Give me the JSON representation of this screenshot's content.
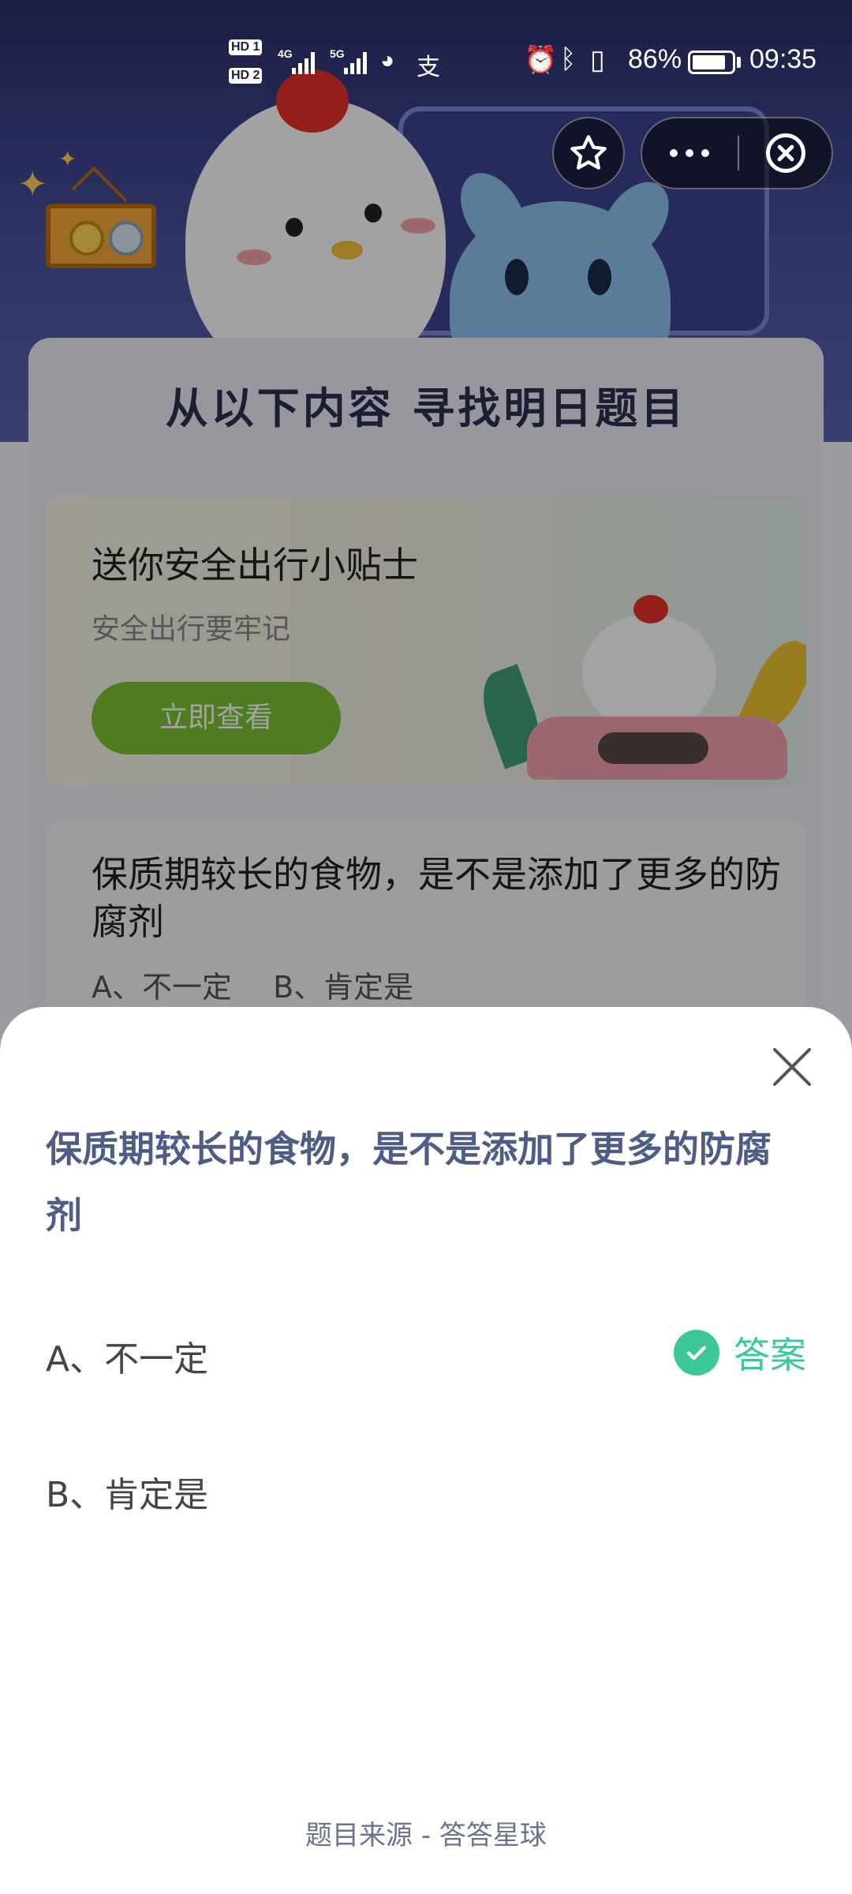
{
  "status_bar": {
    "hd1": "HD 1",
    "hd2": "HD 2",
    "net1": "4G",
    "net2": "5G",
    "app_icons": [
      "wechat-icon",
      "alipay-icon"
    ],
    "battery_percent": 86,
    "battery_text": "86%",
    "time": "09:35"
  },
  "capsule": {
    "favorite_icon": "star-icon",
    "more_icon": "more-dots-icon",
    "close_icon": "circle-close-icon"
  },
  "background": {
    "panel_title": "从以下内容  寻找明日题目",
    "promo": {
      "title": "送你安全出行小贴士",
      "subtitle": "安全出行要牢记",
      "button": "立即查看"
    },
    "quiz_card": {
      "question": "保质期较长的食物，是不是添加了更多的防腐剂",
      "options": "A、不一定    B、肯定是"
    }
  },
  "sheet": {
    "question": "保质期较长的食物，是不是添加了更多的防腐剂",
    "options": [
      {
        "label": "A、不一定",
        "is_answer": true
      },
      {
        "label": "B、肯定是",
        "is_answer": false
      }
    ],
    "answer_label": "答案",
    "source": "题目来源 - 答答星球"
  },
  "colors": {
    "accent_green": "#3cc79a",
    "question_text": "#4f5d86",
    "promo_button": "#7ec234"
  }
}
